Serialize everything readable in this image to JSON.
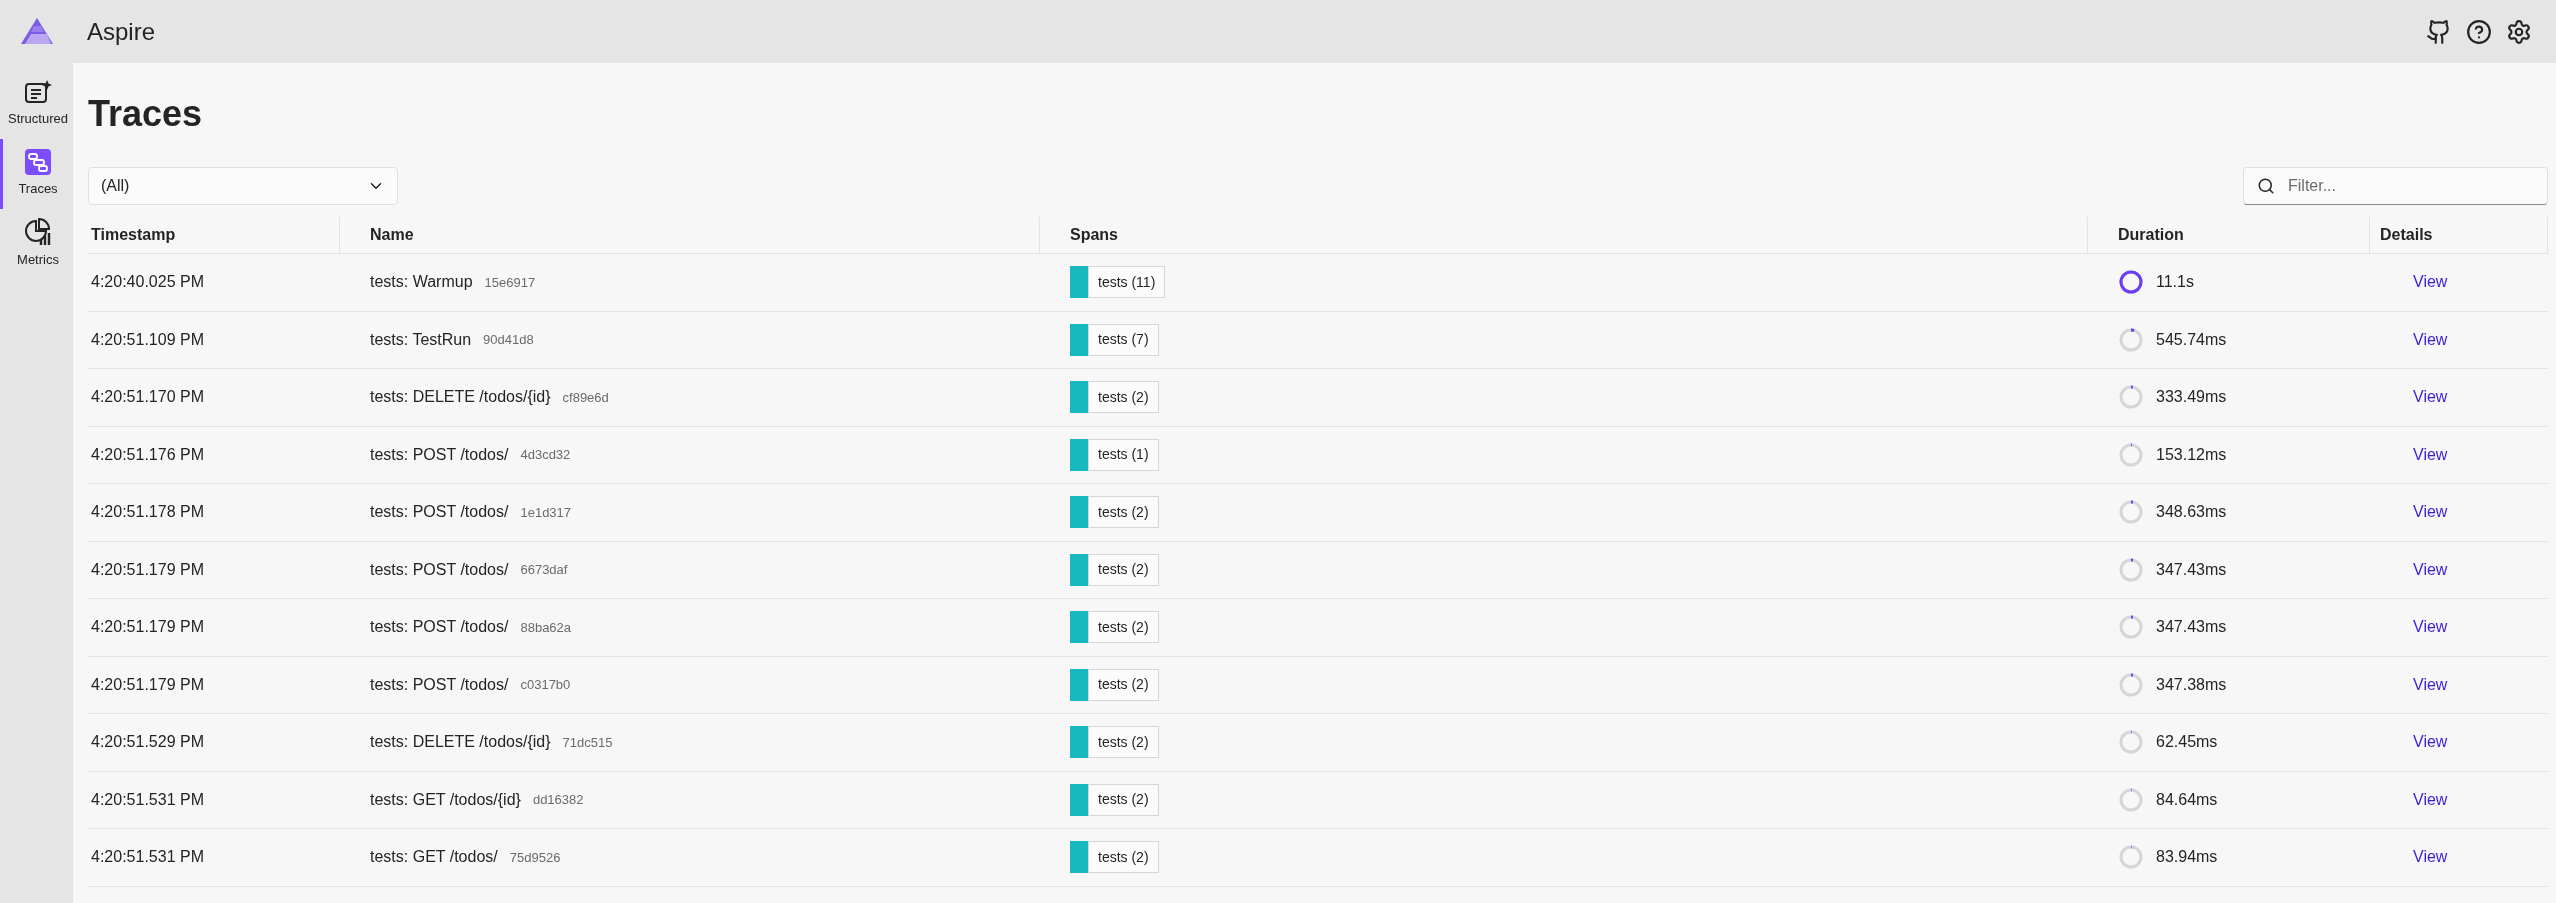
{
  "app": {
    "title": "Aspire"
  },
  "nav": [
    {
      "label": "Structured",
      "kind": "structured",
      "selected": false
    },
    {
      "label": "Traces",
      "kind": "traces",
      "selected": true
    },
    {
      "label": "Metrics",
      "kind": "metrics",
      "selected": false
    }
  ],
  "page": {
    "title": "Traces"
  },
  "resource_select": {
    "value": "(All)"
  },
  "filter": {
    "placeholder": "Filter..."
  },
  "table": {
    "columns": [
      "Timestamp",
      "Name",
      "Spans",
      "Duration",
      "Details"
    ],
    "rows": [
      {
        "timestamp": "4:20:40.025 PM",
        "name": "tests: Warmup",
        "trace_id": "15e6917",
        "spans": "tests (11)",
        "duration": "11.1s",
        "level": 1,
        "details": "View"
      },
      {
        "timestamp": "4:20:51.109 PM",
        "name": "tests: TestRun",
        "trace_id": "90d41d8",
        "spans": "tests (7)",
        "duration": "545.74ms",
        "level": 0.049,
        "details": "View"
      },
      {
        "timestamp": "4:20:51.170 PM",
        "name": "tests: DELETE /todos/{id}",
        "trace_id": "cf89e6d",
        "spans": "tests (2)",
        "duration": "333.49ms",
        "level": 0.03,
        "details": "View"
      },
      {
        "timestamp": "4:20:51.176 PM",
        "name": "tests: POST /todos/",
        "trace_id": "4d3cd32",
        "spans": "tests (1)",
        "duration": "153.12ms",
        "level": 0.014,
        "details": "View"
      },
      {
        "timestamp": "4:20:51.178 PM",
        "name": "tests: POST /todos/",
        "trace_id": "1e1d317",
        "spans": "tests (2)",
        "duration": "348.63ms",
        "level": 0.031,
        "details": "View"
      },
      {
        "timestamp": "4:20:51.179 PM",
        "name": "tests: POST /todos/",
        "trace_id": "6673daf",
        "spans": "tests (2)",
        "duration": "347.43ms",
        "level": 0.031,
        "details": "View"
      },
      {
        "timestamp": "4:20:51.179 PM",
        "name": "tests: POST /todos/",
        "trace_id": "88ba62a",
        "spans": "tests (2)",
        "duration": "347.43ms",
        "level": 0.031,
        "details": "View"
      },
      {
        "timestamp": "4:20:51.179 PM",
        "name": "tests: POST /todos/",
        "trace_id": "c0317b0",
        "spans": "tests (2)",
        "duration": "347.38ms",
        "level": 0.031,
        "details": "View"
      },
      {
        "timestamp": "4:20:51.529 PM",
        "name": "tests: DELETE /todos/{id}",
        "trace_id": "71dc515",
        "spans": "tests (2)",
        "duration": "62.45ms",
        "level": 0.006,
        "details": "View"
      },
      {
        "timestamp": "4:20:51.531 PM",
        "name": "tests: GET /todos/{id}",
        "trace_id": "dd16382",
        "spans": "tests (2)",
        "duration": "84.64ms",
        "level": 0.008,
        "details": "View"
      },
      {
        "timestamp": "4:20:51.531 PM",
        "name": "tests: GET /todos/",
        "trace_id": "75d9526",
        "spans": "tests (2)",
        "duration": "83.94ms",
        "level": 0.008,
        "details": "View"
      }
    ]
  }
}
